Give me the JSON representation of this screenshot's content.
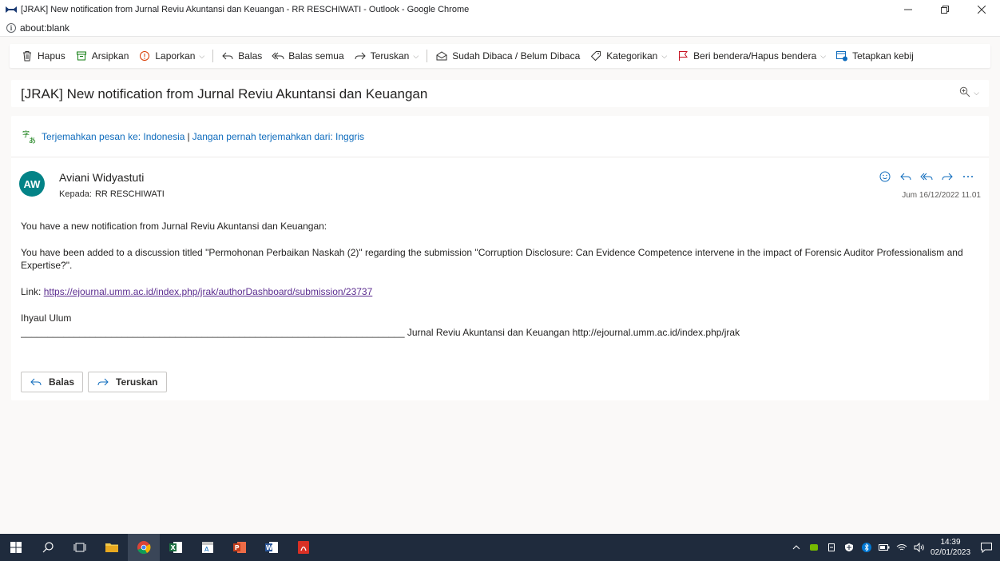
{
  "window": {
    "title": "[JRAK] New notification from Jurnal Reviu Akuntansi dan Keuangan - RR RESCHIWATI - Outlook - Google Chrome",
    "minimize": "—",
    "restore": "▢",
    "close": "✕"
  },
  "address": {
    "url": "about:blank"
  },
  "toolbar": {
    "delete": "Hapus",
    "archive": "Arsipkan",
    "report": "Laporkan",
    "reply": "Balas",
    "reply_all": "Balas semua",
    "forward": "Teruskan",
    "read_unread": "Sudah Dibaca / Belum Dibaca",
    "categorize": "Kategorikan",
    "flag": "Beri bendera/Hapus bendera",
    "policy": "Tetapkan kebij"
  },
  "message": {
    "subject": "[JRAK] New notification from Jurnal Reviu Akuntansi dan Keuangan",
    "translate_link": "Terjemahkan pesan ke: Indonesia",
    "translate_sep": "|",
    "never_translate_link": "Jangan pernah terjemahkan dari: Inggris",
    "avatar_initials": "AW",
    "sender": "Aviani Widyastuti",
    "to_label": "Kepada:",
    "to_value": "RR RESCHIWATI",
    "date": "Jum 16/12/2022 11.01",
    "body": {
      "p1": "You have a new notification from Jurnal Reviu Akuntansi dan Keuangan:",
      "p2": "You have been added to a discussion titled \"Permohonan Perbaikan Naskah (2)\" regarding the submission \"Corruption Disclosure: Can Evidence Competence intervene in the impact of Forensic Auditor Professionalism and Expertise?\".",
      "link_label": "Link:",
      "link_url": "https://ejournal.umm.ac.id/index.php/jrak/authorDashboard/submission/23737",
      "sig_name": "Ihyaul Ulum",
      "sig_line": "________________________________________________________________________ Jurnal Reviu Akuntansi dan Keuangan http://ejournal.umm.ac.id/index.php/jrak"
    },
    "reply_button": "Balas",
    "forward_button": "Teruskan"
  },
  "taskbar": {
    "time": "14:39",
    "date": "02/01/2023"
  },
  "colors": {
    "accent": "#0f6cbd",
    "avatar": "#038387",
    "flag": "#c50f1f",
    "taskbar": "#1f2b3d"
  }
}
